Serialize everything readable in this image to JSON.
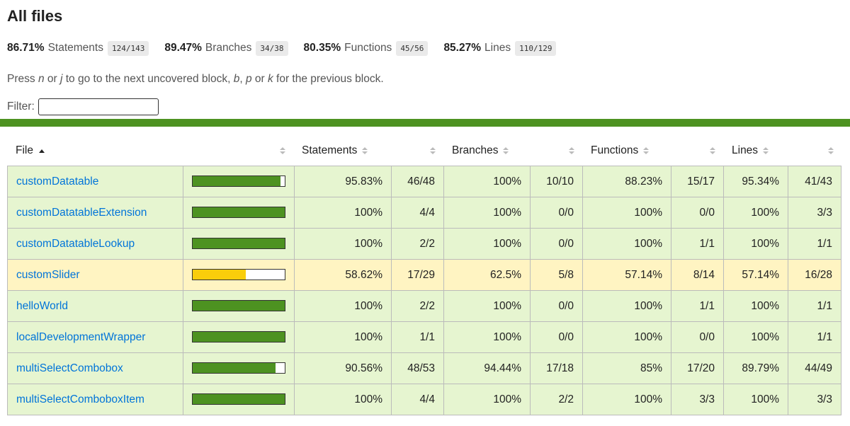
{
  "title": "All files",
  "summary": [
    {
      "pct": "86.71%",
      "label": "Statements",
      "frac": "124/143"
    },
    {
      "pct": "89.47%",
      "label": "Branches",
      "frac": "34/38"
    },
    {
      "pct": "80.35%",
      "label": "Functions",
      "frac": "45/56"
    },
    {
      "pct": "85.27%",
      "label": "Lines",
      "frac": "110/129"
    }
  ],
  "hint": {
    "p1": "Press ",
    "k1": "n",
    "p2": " or ",
    "k2": "j",
    "p3": " to go to the next uncovered block, ",
    "k3": "b",
    "p4": ", ",
    "k4": "p",
    "p5": " or ",
    "k5": "k",
    "p6": " for the previous block."
  },
  "filter": {
    "label": "Filter:",
    "value": ""
  },
  "colors": {
    "high_row": "#e6f5d0",
    "medium_row": "#fff4c2",
    "high_fill": "#4d9221",
    "medium_fill": "#f9cd0b",
    "link": "#0074d9",
    "accent_bar": "#4d9221"
  },
  "table": {
    "headers": {
      "file": "File",
      "statements": "Statements",
      "branches": "Branches",
      "functions": "Functions",
      "lines": "Lines"
    },
    "rows": [
      {
        "file": "customDatatable",
        "level": "high",
        "coverage": 95.83,
        "stmt_pct": "95.83%",
        "stmt_frac": "46/48",
        "br_pct": "100%",
        "br_frac": "10/10",
        "fn_pct": "88.23%",
        "fn_frac": "15/17",
        "ln_pct": "95.34%",
        "ln_frac": "41/43"
      },
      {
        "file": "customDatatableExtension",
        "level": "high",
        "coverage": 100,
        "stmt_pct": "100%",
        "stmt_frac": "4/4",
        "br_pct": "100%",
        "br_frac": "0/0",
        "fn_pct": "100%",
        "fn_frac": "0/0",
        "ln_pct": "100%",
        "ln_frac": "3/3"
      },
      {
        "file": "customDatatableLookup",
        "level": "high",
        "coverage": 100,
        "stmt_pct": "100%",
        "stmt_frac": "2/2",
        "br_pct": "100%",
        "br_frac": "0/0",
        "fn_pct": "100%",
        "fn_frac": "1/1",
        "ln_pct": "100%",
        "ln_frac": "1/1"
      },
      {
        "file": "customSlider",
        "level": "medium",
        "coverage": 58.62,
        "stmt_pct": "58.62%",
        "stmt_frac": "17/29",
        "br_pct": "62.5%",
        "br_frac": "5/8",
        "fn_pct": "57.14%",
        "fn_frac": "8/14",
        "ln_pct": "57.14%",
        "ln_frac": "16/28"
      },
      {
        "file": "helloWorld",
        "level": "high",
        "coverage": 100,
        "stmt_pct": "100%",
        "stmt_frac": "2/2",
        "br_pct": "100%",
        "br_frac": "0/0",
        "fn_pct": "100%",
        "fn_frac": "1/1",
        "ln_pct": "100%",
        "ln_frac": "1/1"
      },
      {
        "file": "localDevelopmentWrapper",
        "level": "high",
        "coverage": 100,
        "stmt_pct": "100%",
        "stmt_frac": "1/1",
        "br_pct": "100%",
        "br_frac": "0/0",
        "fn_pct": "100%",
        "fn_frac": "0/0",
        "ln_pct": "100%",
        "ln_frac": "1/1"
      },
      {
        "file": "multiSelectCombobox",
        "level": "high",
        "coverage": 90.56,
        "stmt_pct": "90.56%",
        "stmt_frac": "48/53",
        "br_pct": "94.44%",
        "br_frac": "17/18",
        "fn_pct": "85%",
        "fn_frac": "17/20",
        "ln_pct": "89.79%",
        "ln_frac": "44/49"
      },
      {
        "file": "multiSelectComboboxItem",
        "level": "high",
        "coverage": 100,
        "stmt_pct": "100%",
        "stmt_frac": "4/4",
        "br_pct": "100%",
        "br_frac": "2/2",
        "fn_pct": "100%",
        "fn_frac": "3/3",
        "ln_pct": "100%",
        "ln_frac": "3/3"
      }
    ]
  }
}
